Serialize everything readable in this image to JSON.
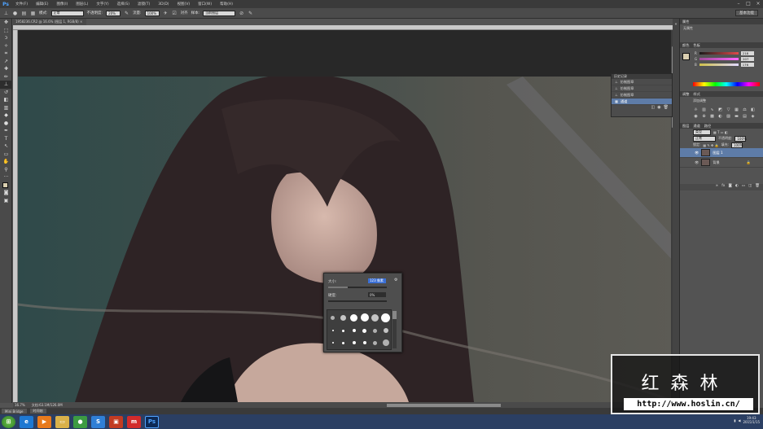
{
  "app": {
    "logo": "Ps",
    "window_controls": [
      "–",
      "□",
      "×"
    ]
  },
  "menu": [
    "文件(F)",
    "编辑(E)",
    "图像(I)",
    "图层(L)",
    "文字(Y)",
    "选择(S)",
    "滤镜(T)",
    "3D(D)",
    "视图(V)",
    "窗口(W)",
    "帮助(H)"
  ],
  "options": {
    "mode_label": "模式:",
    "mode_value": "正常",
    "opacity_label": "不透明度:",
    "opacity_value": "20%",
    "flow_label": "流量:",
    "flow_value": "100%",
    "align_label": "对齐",
    "sample_label": "样本:",
    "sample_value": "当前图层"
  },
  "workspace_button": "基本功能",
  "document_tab": "1958236.CR2 @ 16.6% (图层 1, RGB/8) ×",
  "status": {
    "zoom": "16.7%",
    "doc": "文档:63.1M/126.0M"
  },
  "minibridge": {
    "tabs": [
      "Mini Bridge",
      "时间轴"
    ]
  },
  "history": {
    "title": "历史记录",
    "items": [
      {
        "label": "仿制图章",
        "selected": false
      },
      {
        "label": "仿制图章",
        "selected": false
      },
      {
        "label": "仿制图章",
        "selected": false
      },
      {
        "label": "通道",
        "selected": true
      }
    ]
  },
  "panels": {
    "attrs_tab": "属性",
    "info_tab": "无属性",
    "color_tabs": [
      "颜色",
      "色板"
    ],
    "rgb": [
      {
        "ch": "R",
        "value": "218",
        "color": "#e04a4a"
      },
      {
        "ch": "G",
        "value": "207",
        "color": "#4ae04a"
      },
      {
        "ch": "B",
        "value": "176",
        "color": "#4a7ae0"
      }
    ],
    "adjust_tabs": [
      "调整",
      "样式"
    ],
    "adjust_add": "添加调整",
    "layers_tabs": [
      "图层",
      "通道",
      "路径"
    ],
    "kind_label": "类型",
    "blend_mode": "正常",
    "opacity_label": "不透明度:",
    "opacity": "100%",
    "lock_label": "锁定:",
    "fill_label": "填充:",
    "fill": "100%",
    "layers": [
      {
        "name": "图层 1",
        "selected": true
      },
      {
        "name": "背景",
        "selected": false
      }
    ]
  },
  "brush_popup": {
    "size_label": "大小:",
    "size_value": "123 像素",
    "hardness_label": "硬度:",
    "hardness_value": "0%",
    "brush_sizes": [
      "1",
      "3",
      "5",
      "9",
      "13",
      "19",
      "5",
      "9",
      "13",
      "17",
      "21",
      "27",
      "35",
      "45",
      "65",
      "100",
      "200",
      "300"
    ]
  },
  "watermark": {
    "title": "红森林",
    "url": "http://www.hoslin.cn/"
  },
  "tray": {
    "time": "19:43",
    "date": "2015/1/15"
  },
  "taskbar_apps": [
    {
      "name": "ie",
      "color": "#1e78d2",
      "glyph": "e"
    },
    {
      "name": "media",
      "color": "#e87a1c",
      "glyph": "▶"
    },
    {
      "name": "folder",
      "color": "#d9b14a",
      "glyph": "▭"
    },
    {
      "name": "chrome",
      "color": "#3c9b42",
      "glyph": "●"
    },
    {
      "name": "sogou",
      "color": "#2f7fd6",
      "glyph": "S"
    },
    {
      "name": "office",
      "color": "#c23b22",
      "glyph": "▣"
    },
    {
      "name": "maxthon",
      "color": "#d22b2b",
      "glyph": "m"
    },
    {
      "name": "photoshop",
      "color": "#0d2a56",
      "glyph": "Ps"
    }
  ]
}
